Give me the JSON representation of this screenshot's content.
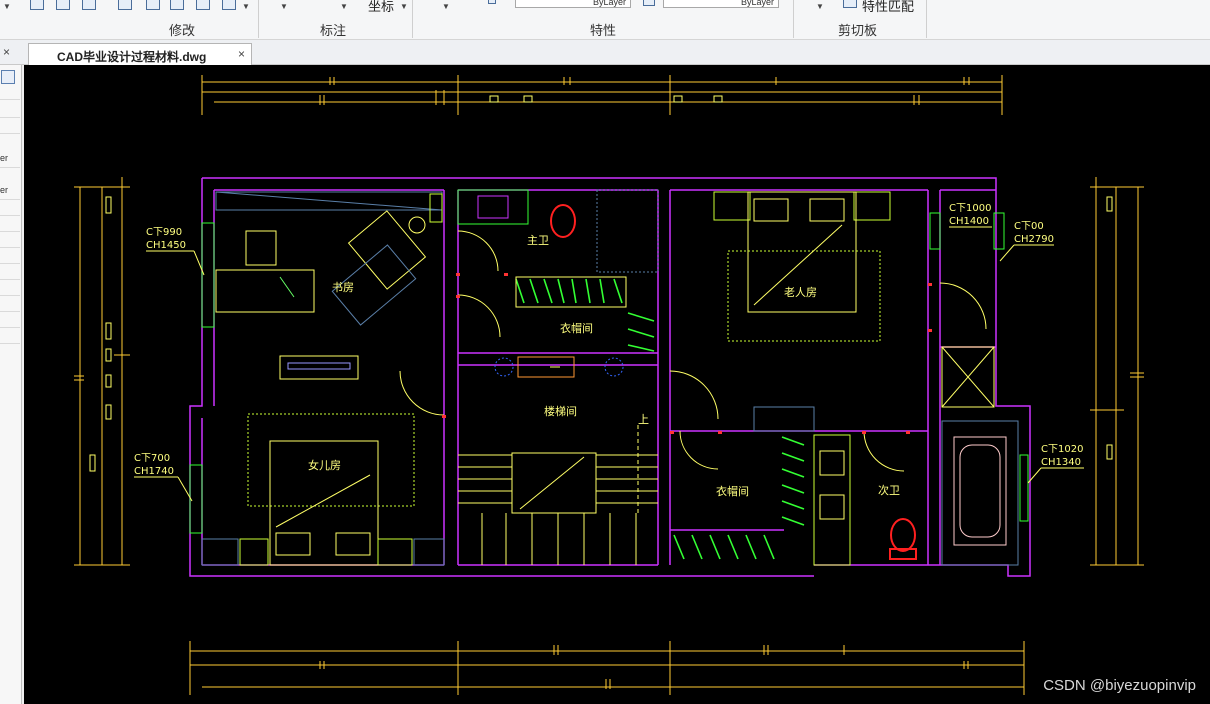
{
  "ribbon": {
    "groups": {
      "modify": "修改",
      "annotate": "标注",
      "properties": "特性",
      "clipboard": "剪切板"
    },
    "coordinate_button": "坐标",
    "match_properties_button": "特性匹配",
    "bylayer_1": "ByLayer",
    "bylayer_2": "ByLayer"
  },
  "tabs": {
    "document_title": "CAD毕业设计过程材料.dwg",
    "close_glyph": "×",
    "side_close_glyph": "×"
  },
  "sidepanel": {
    "fragment_1": "er",
    "fragment_2": "er"
  },
  "drawing": {
    "rooms": {
      "study": "书房",
      "master_bath": "主卫",
      "cloakroom_top": "衣帽间",
      "elder_room": "老人房",
      "staircase": "楼梯间",
      "up": "上",
      "daughter_room": "女儿房",
      "cloakroom_bottom": "衣帽间",
      "second_bath": "次卫"
    },
    "window_tags": {
      "w1": [
        "C下990",
        "CH1450"
      ],
      "w2": [
        "C下700",
        "CH1740"
      ],
      "w3": [
        "C下1000",
        "CH1400"
      ],
      "w4": [
        "C下00",
        "CH2790"
      ],
      "w5": [
        "C下1020",
        "CH1340"
      ]
    },
    "colors": {
      "background": "#000000",
      "wall": "#cc33ff",
      "furniture": "#ffff66",
      "wardrobe": "#33ff33",
      "dimension": "#ffcc33",
      "door_mark": "#ff3333",
      "fixture": "#ff2020",
      "cabinet": "#5a7fa8"
    }
  },
  "watermark": "CSDN @biyezuopinvip"
}
